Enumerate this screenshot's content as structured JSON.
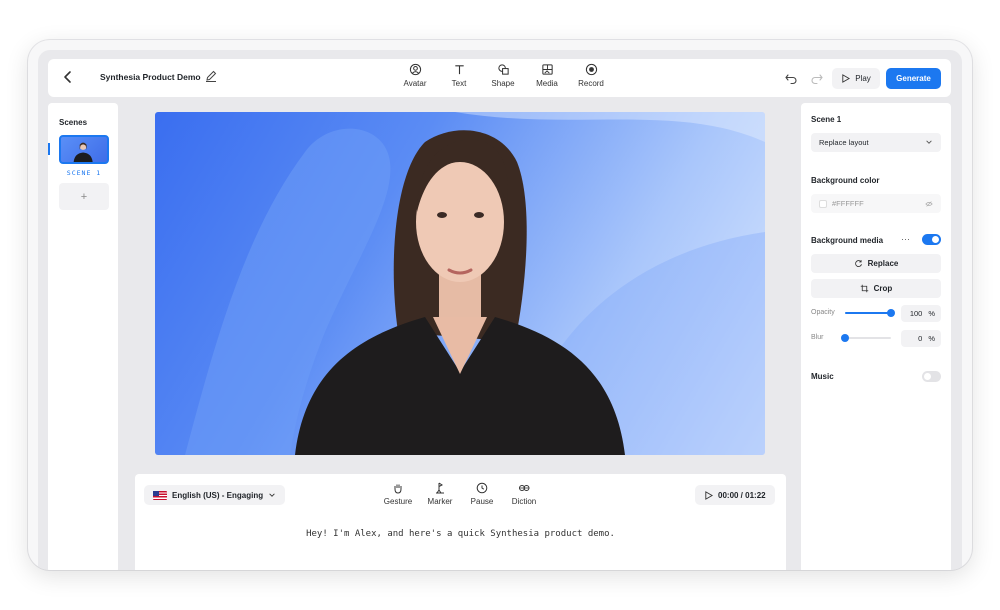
{
  "header": {
    "project_title": "Synthesia Product Demo",
    "tools": [
      {
        "label": "Avatar",
        "icon": "avatar-icon"
      },
      {
        "label": "Text",
        "icon": "text-icon"
      },
      {
        "label": "Shape",
        "icon": "shape-icon"
      },
      {
        "label": "Media",
        "icon": "media-icon"
      },
      {
        "label": "Record",
        "icon": "record-icon"
      }
    ],
    "play_label": "Play",
    "generate_label": "Generate"
  },
  "scenes": {
    "title": "Scenes",
    "items": [
      {
        "label": "SCENE 1"
      }
    ],
    "add_label": "+"
  },
  "script": {
    "language": "English (US) - Engaging",
    "tools": [
      {
        "label": "Gesture",
        "icon": "gesture-icon"
      },
      {
        "label": "Marker",
        "icon": "marker-icon"
      },
      {
        "label": "Pause",
        "icon": "pause-clock-icon"
      },
      {
        "label": "Diction",
        "icon": "diction-icon"
      }
    ],
    "timer": "00:00 / 01:22",
    "text": "Hey! I'm Alex, and here's a quick Synthesia product demo."
  },
  "panel": {
    "scene_title": "Scene 1",
    "layout_select": "Replace layout",
    "bg_color_title": "Background color",
    "bg_color_value": "#FFFFFF",
    "bg_media_title": "Background media",
    "bg_media_enabled": true,
    "replace_label": "Replace",
    "crop_label": "Crop",
    "opacity_label": "Opacity",
    "opacity_value": "100",
    "blur_label": "Blur",
    "blur_value": "0",
    "percent": "%",
    "music_title": "Music",
    "music_enabled": false
  },
  "colors": {
    "accent": "#1c78f0",
    "canvas_gradient_start": "#3a6ef0",
    "canvas_gradient_end": "#dbe8fe"
  }
}
